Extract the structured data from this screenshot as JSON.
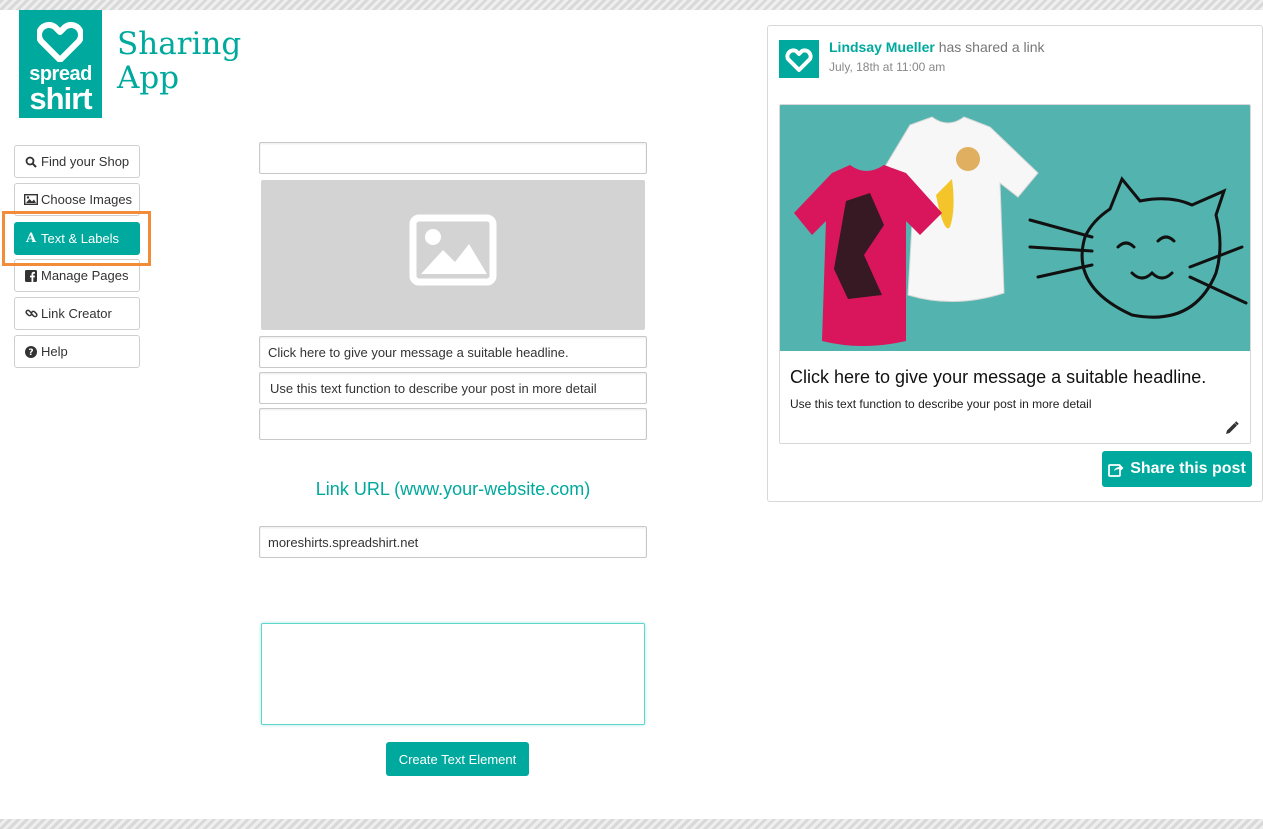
{
  "brand": {
    "logo_word_1": "spread",
    "logo_word_2": "shirt",
    "app_title_line1": "Sharing",
    "app_title_line2": "App",
    "accent_color": "#00a99d",
    "highlight_color": "#f28c38"
  },
  "sidebar": {
    "items": [
      {
        "label": "Find your Shop",
        "icon": "search-icon",
        "active": false
      },
      {
        "label": "Choose Images",
        "icon": "image-icon",
        "active": false
      },
      {
        "label": "Text & Labels",
        "icon": "font-icon",
        "active": true
      },
      {
        "label": "Manage Pages",
        "icon": "facebook-icon",
        "active": false
      },
      {
        "label": "Link Creator",
        "icon": "link-icon",
        "active": false
      },
      {
        "label": "Help",
        "icon": "help-icon",
        "active": false
      }
    ]
  },
  "form": {
    "top_field_value": "",
    "image_placeholder_icon": "image-placeholder-icon",
    "headline_value": "Click here to give your message a suitable headline.",
    "description_value": "Use this text function to describe your post in more detail",
    "extra_field_value": "",
    "link_label": "Link URL (www.your-website.com)",
    "link_value": "moreshirts.spreadshirt.net",
    "textarea_value": "",
    "create_button": "Create Text Element"
  },
  "preview": {
    "user_name": "Lindsay Mueller",
    "action_text": "has shared a link",
    "date": "July, 18th at 11:00 am",
    "headline": "Click here to give your message a suitable headline.",
    "description": "Use this text function to describe your post in more detail",
    "edit_icon": "pencil-icon",
    "share_button": "Share this post",
    "share_icon": "share-icon",
    "image_bg_color": "#53b3ae"
  }
}
